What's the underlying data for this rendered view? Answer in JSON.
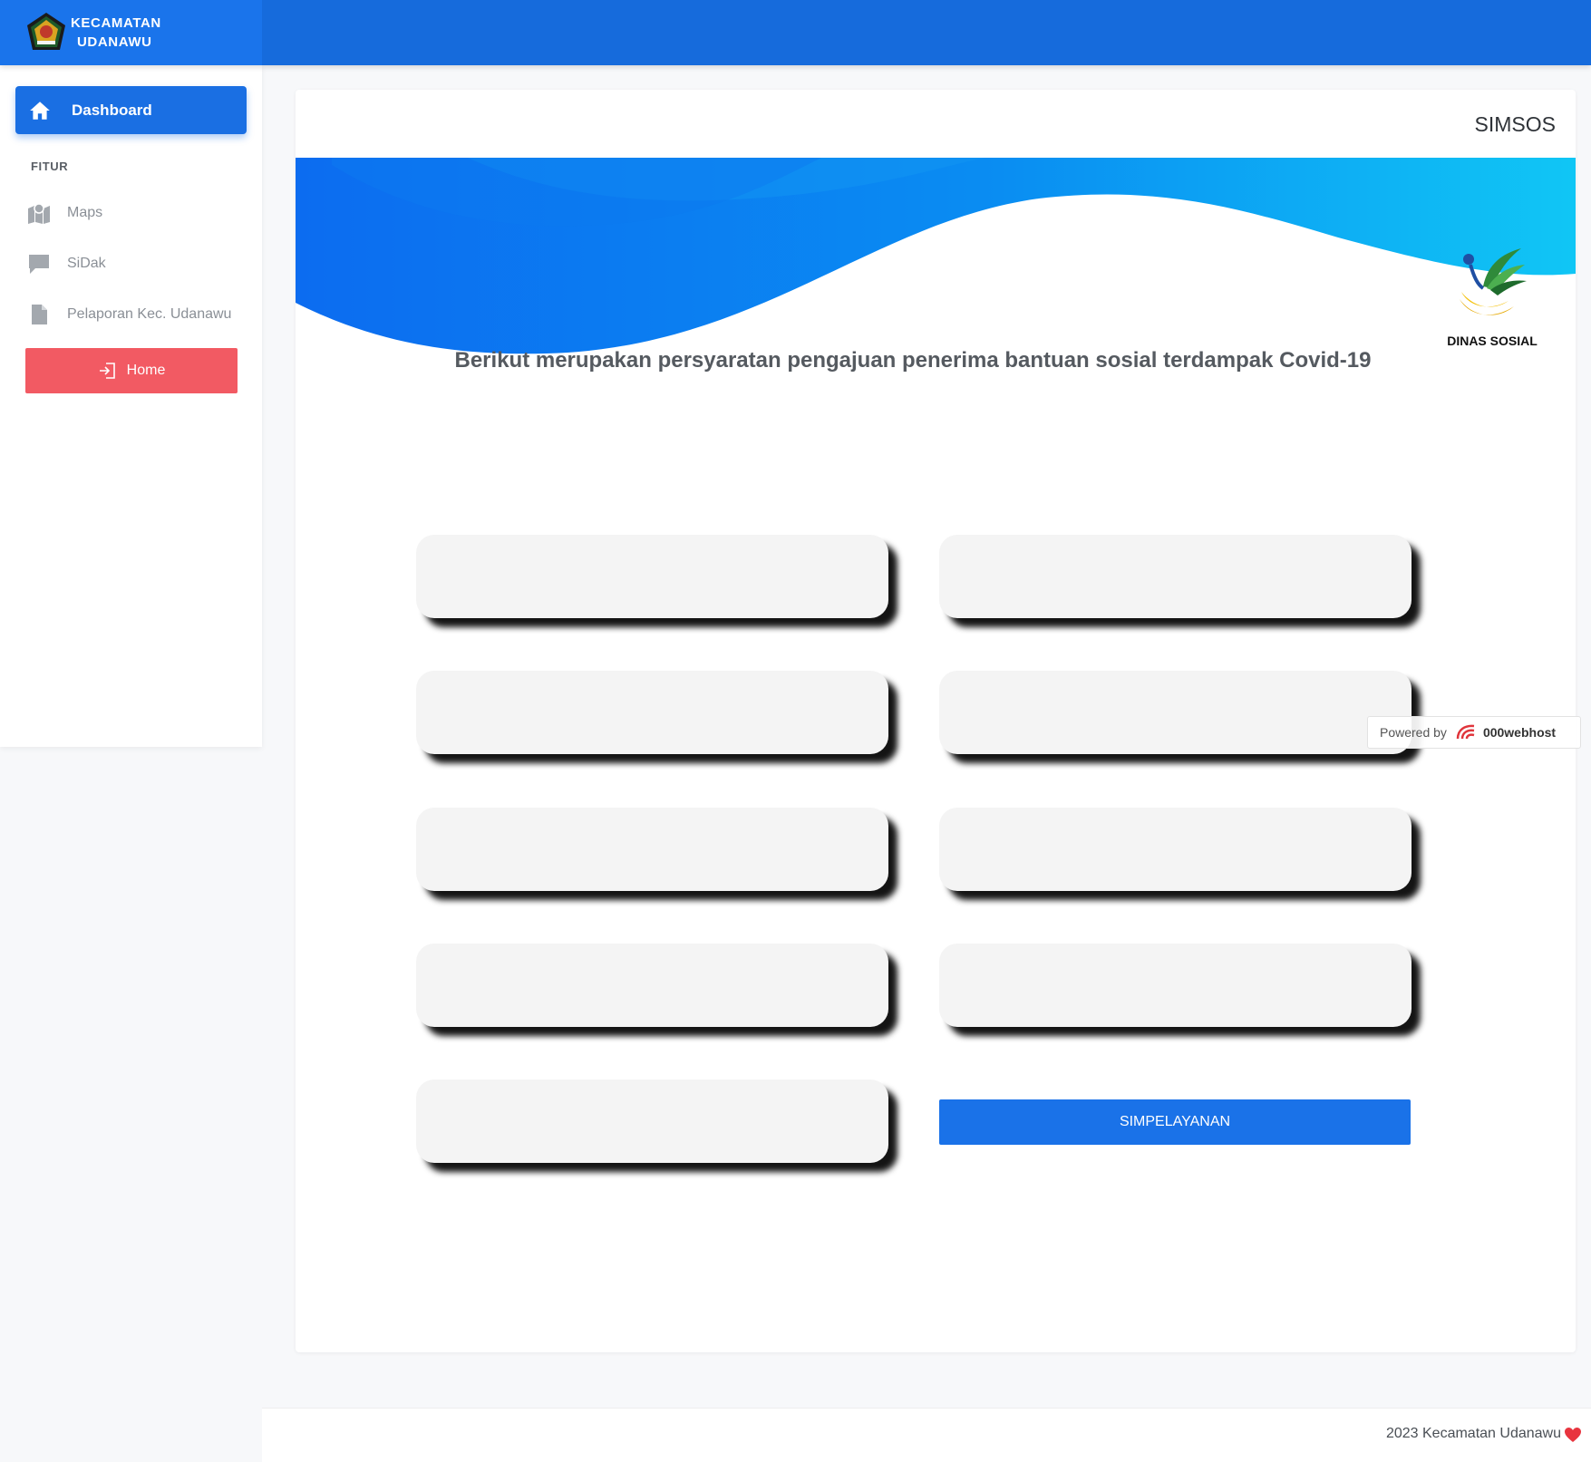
{
  "header": {
    "brand_line1": "KECAMATAN",
    "brand_line2": "UDANAWU",
    "bar_color": "#166bdc"
  },
  "sidebar": {
    "dashboard_label": "Dashboard",
    "section_title": "FITUR",
    "items": [
      {
        "label": "Maps",
        "icon": "map-icon"
      },
      {
        "label": "SiDak",
        "icon": "chat-icon"
      },
      {
        "label": "Pelaporan Kec. Udanawu",
        "icon": "document-icon"
      }
    ],
    "home_label": "Home",
    "home_color": "#f25a63"
  },
  "main": {
    "title": "SIMSOS",
    "logo_caption": "DINAS SOSIAL",
    "intro": "Berikut merupakan persyaratan pengajuan penerima bantuan sosial terdampak Covid-19",
    "simpelayanan_label": "SIMPELAYANAN"
  },
  "powered": {
    "prefix": "Powered by",
    "brand": "000webhost"
  },
  "footer": {
    "text": "2023 Kecamatan Udanawu"
  }
}
